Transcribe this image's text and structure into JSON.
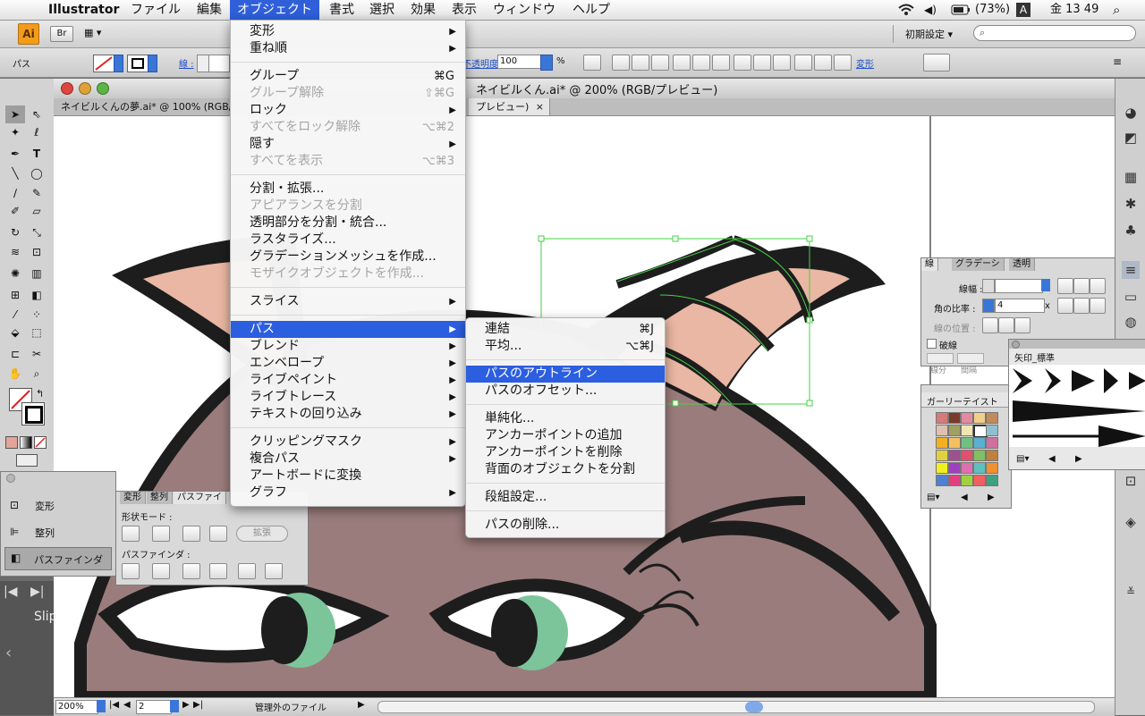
{
  "menubar": {
    "app": "Illustrator",
    "items": [
      "ファイル",
      "編集",
      "オブジェクト",
      "書式",
      "選択",
      "効果",
      "表示",
      "ウィンドウ",
      "ヘルプ"
    ],
    "active": "オブジェクト",
    "battery": "(73%)",
    "input_mode": "A",
    "clock": "金 13 49"
  },
  "appbar": {
    "logo": "Ai",
    "bridge": "Br",
    "workspace": "初期設定 ▾"
  },
  "ctrlbar": {
    "selection_label": "パス",
    "stroke_label": "線 :",
    "opacity_label": "不透明度 :",
    "opacity_value": "100",
    "percent": "%",
    "transform_label": "変形"
  },
  "document": {
    "window_title": "ネイビルくん.ai* @ 200% (RGB/プレビュー)",
    "tab1": "ネイビルくんの夢.ai* @ 100% (RGB/",
    "tab2": "プレビュー)",
    "tab_close": "×"
  },
  "status": {
    "zoom": "200%",
    "artboard": "2",
    "info": "管理外のファイル"
  },
  "object_menu": [
    {
      "label": "変形",
      "sub": true
    },
    {
      "label": "重ね順",
      "sub": true
    },
    {
      "sep": true
    },
    {
      "label": "グループ",
      "sc": "⌘G"
    },
    {
      "label": "グループ解除",
      "sc": "⇧⌘G",
      "dis": true
    },
    {
      "label": "ロック",
      "sub": true
    },
    {
      "label": "すべてをロック解除",
      "sc": "⌥⌘2",
      "dis": true
    },
    {
      "label": "隠す",
      "sub": true
    },
    {
      "label": "すべてを表示",
      "sc": "⌥⌘3",
      "dis": true
    },
    {
      "sep": true
    },
    {
      "label": "分割・拡張..."
    },
    {
      "label": "アピアランスを分割",
      "dis": true
    },
    {
      "label": "透明部分を分割・統合..."
    },
    {
      "label": "ラスタライズ..."
    },
    {
      "label": "グラデーションメッシュを作成..."
    },
    {
      "label": "モザイクオブジェクトを作成...",
      "dis": true
    },
    {
      "sep": true
    },
    {
      "label": "スライス",
      "sub": true
    },
    {
      "sep": true
    },
    {
      "label": "パス",
      "sub": true,
      "hl": true
    },
    {
      "label": "ブレンド",
      "sub": true
    },
    {
      "label": "エンベロープ",
      "sub": true
    },
    {
      "label": "ライブペイント",
      "sub": true
    },
    {
      "label": "ライブトレース",
      "sub": true
    },
    {
      "label": "テキストの回り込み",
      "sub": true
    },
    {
      "sep": true
    },
    {
      "label": "クリッピングマスク",
      "sub": true
    },
    {
      "label": "複合パス",
      "sub": true
    },
    {
      "label": "アートボードに変換"
    },
    {
      "label": "グラフ",
      "sub": true
    }
  ],
  "path_menu": [
    {
      "label": "連結",
      "sc": "⌘J"
    },
    {
      "label": "平均...",
      "sc": "⌥⌘J"
    },
    {
      "sep": true
    },
    {
      "label": "パスのアウトライン",
      "hl": true
    },
    {
      "label": "パスのオフセット..."
    },
    {
      "sep": true
    },
    {
      "label": "単純化..."
    },
    {
      "label": "アンカーポイントの追加"
    },
    {
      "label": "アンカーポイントを削除"
    },
    {
      "label": "背面のオブジェクトを分割"
    },
    {
      "sep": true
    },
    {
      "label": "段組設定..."
    },
    {
      "sep": true
    },
    {
      "label": "パスの削除..."
    }
  ],
  "stroke_panel": {
    "tabs": [
      "線",
      "グラデーシ",
      "透明"
    ],
    "weight_label": "線幅 :",
    "miter_label": "角の比率 :",
    "miter_value": "4",
    "miter_unit": "x",
    "align_label": "線の位置 :",
    "dashed_label": "破線",
    "dash_label": "線分",
    "gap_label": "間隔"
  },
  "swatch_panel": {
    "title": "ガーリーテイスト"
  },
  "brush_panel": {
    "title": "矢印_標準"
  },
  "left_panel": {
    "items": [
      "変形",
      "整列",
      "パスファインダ"
    ]
  },
  "pathfinder_panel": {
    "tabs": [
      "変形",
      "整列",
      "パスファイ"
    ],
    "shape_modes": "形状モード :",
    "expand": "拡張",
    "pathfinders": "パスファインダ :"
  },
  "bottom_strip": {
    "text": "Slip"
  },
  "colors": {
    "accent": "#2f5fd9",
    "skin": "#9b7c7c",
    "horn": "#e9b7a3",
    "eye": "#7cc59a",
    "outline": "#1d1d1d",
    "selection": "#46d046"
  }
}
